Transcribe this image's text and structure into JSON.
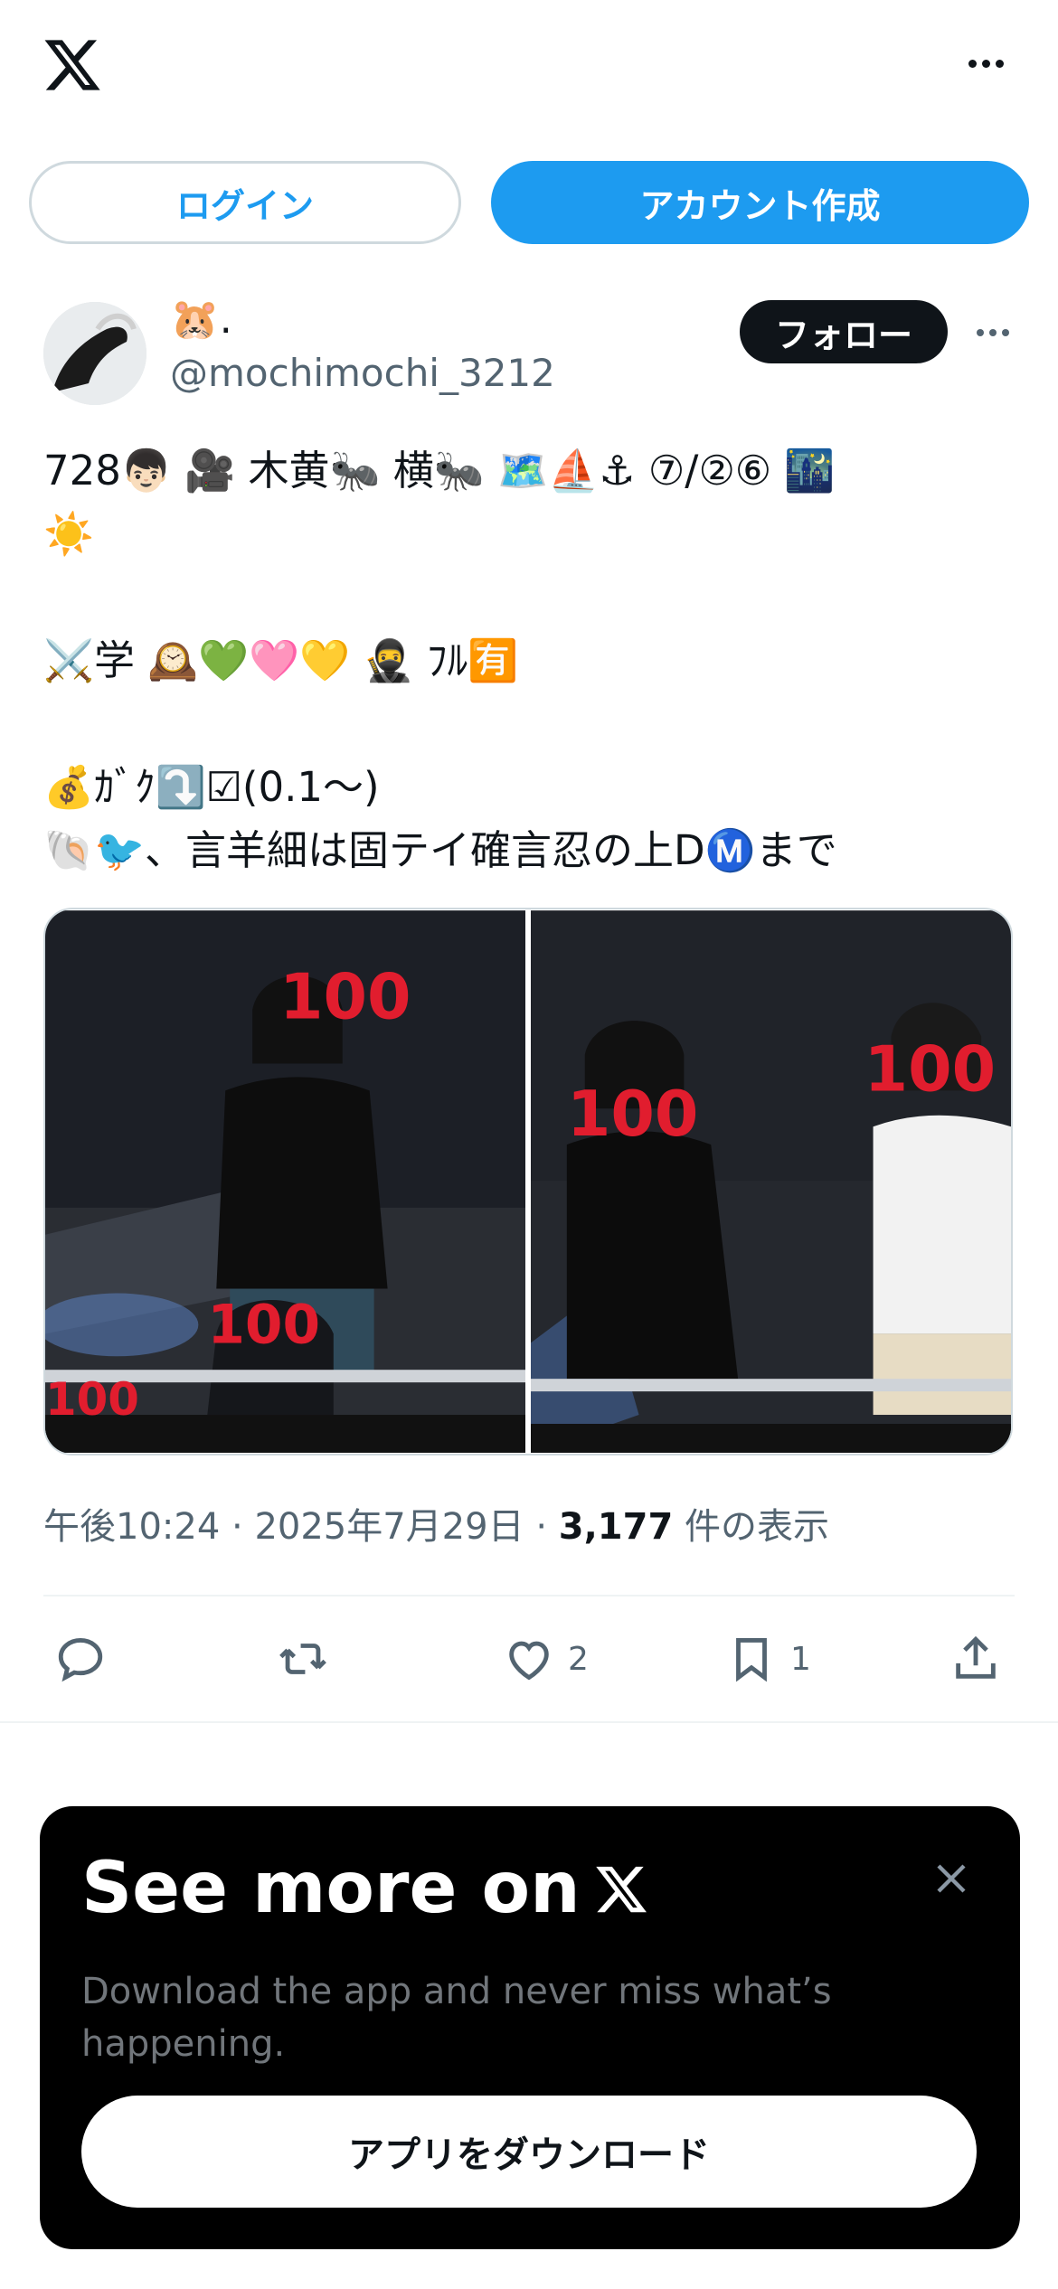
{
  "header": {
    "logo_icon": "x-logo-icon",
    "more_icon": "more-horizontal-icon"
  },
  "auth": {
    "login_label": "ログイン",
    "signup_label": "アカウント作成"
  },
  "post": {
    "display_name": "🐹.",
    "handle": "@mochimochi_3212",
    "follow_label": "フォロー",
    "text": "728👦🏻 🎥 木黄🐜 横🐜 🗺️⛵⚓ ⑦/②⑥ 🌃\n☀️\n\n⚔️学 🕰️💚🩷💛 🥷 ﾌﾙ🈶\n\n💰ｶﾞｸ⤵️☑(0.1〜)\n🐚🐦、言羊細は固テイ確言忍の上DⓂ️まで",
    "media_alt": [
      "photo-1",
      "photo-2"
    ],
    "time": "午後10:24",
    "date": "2025年7月29日",
    "views_count": "3,177",
    "views_label": "件の表示",
    "separator": "·",
    "likes": "2",
    "bookmarks": "1"
  },
  "promo": {
    "title": "See more on",
    "subtitle": "Download the app and never miss what’s happening.",
    "button_label": "アプリをダウンロード"
  },
  "colors": {
    "accent": "#1d9bf0",
    "text_primary": "#0f1419",
    "text_secondary": "#536471",
    "border": "#cfd9de"
  }
}
